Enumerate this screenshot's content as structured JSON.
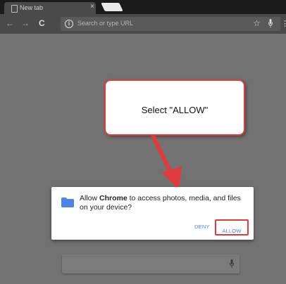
{
  "tab": {
    "title": "New tab",
    "close": "×"
  },
  "toolbar": {
    "back": "←",
    "forward": "→",
    "reload": "C",
    "search_placeholder": "Search or type URL",
    "info": "i",
    "star": "☆",
    "menu": "⋮"
  },
  "callout": {
    "text": "Select \"ALLOW\""
  },
  "dialog": {
    "message_pre": "Allow ",
    "message_app": "Chrome",
    "message_post": " to access photos, media, and files on your device?",
    "deny_label": "DENY",
    "allow_label": "ALLOW"
  },
  "colors": {
    "annotation_red": "#e23a3a",
    "button_blue": "#4a86e8",
    "folder_blue": "#4a86e8"
  },
  "icons": [
    "page-icon",
    "close-icon",
    "back-arrow-icon",
    "forward-arrow-icon",
    "reload-icon",
    "info-icon",
    "star-icon",
    "mic-icon",
    "menu-icon",
    "folder-icon",
    "red-arrow-icon"
  ]
}
